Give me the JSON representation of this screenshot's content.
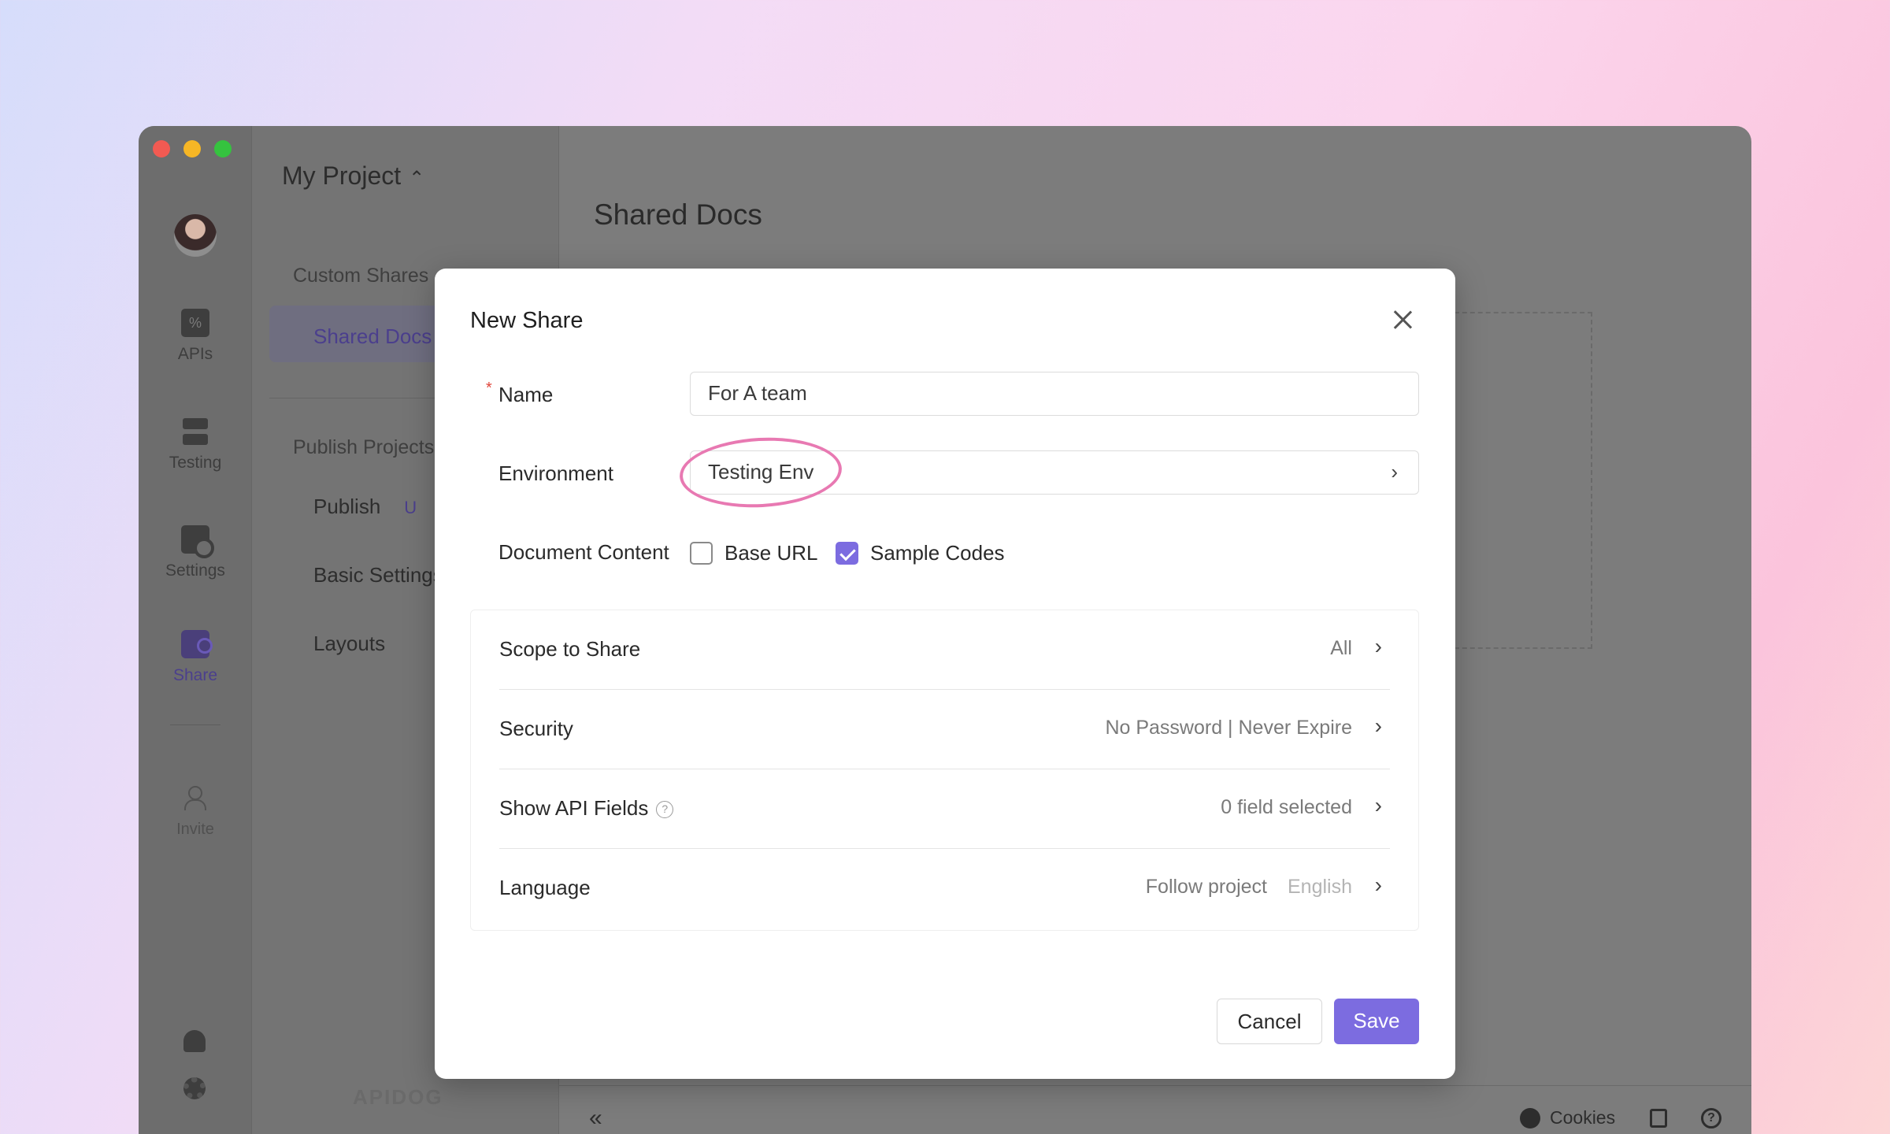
{
  "app": {
    "project": "My Project",
    "main_title": "Shared Docs"
  },
  "rail": {
    "items": [
      {
        "label": "APIs",
        "icon": "apis-icon"
      },
      {
        "label": "Testing",
        "icon": "testing-icon"
      },
      {
        "label": "Settings",
        "icon": "settings-icon"
      },
      {
        "label": "Share",
        "icon": "share-icon"
      },
      {
        "label": "Invite",
        "icon": "invite-icon"
      }
    ]
  },
  "nav": {
    "section_custom": "Custom Shares",
    "item_shared_docs": "Shared Docs",
    "section_publish": "Publish Projects",
    "item_publish": "Publish",
    "item_publish_tag": "U",
    "item_basic_settings": "Basic Settings",
    "item_layouts": "Layouts",
    "watermark": "APIDOG"
  },
  "bottom_bar": {
    "collapse": "«",
    "cookies": "Cookies",
    "help": "?"
  },
  "modal": {
    "title": "New Share",
    "required_mark": "*",
    "name_label": "Name",
    "name_value": "For A team",
    "environment_label": "Environment",
    "environment_value": "Testing Env",
    "document_content_label": "Document Content",
    "base_url_label": "Base URL",
    "base_url_checked": false,
    "sample_codes_label": "Sample Codes",
    "sample_codes_checked": true,
    "rows": [
      {
        "label": "Scope to Share",
        "value": "All"
      },
      {
        "label": "Security",
        "value": "No Password | Never Expire"
      },
      {
        "label": "Show API Fields",
        "value": "0 field selected",
        "help": "?"
      },
      {
        "label": "Language",
        "value": "Follow project",
        "secondary": "English"
      }
    ],
    "cancel_label": "Cancel",
    "save_label": "Save",
    "arrow": "›"
  },
  "colors": {
    "accent": "#7c6ce0",
    "annotation": "#e879b2",
    "required": "#e0453b"
  }
}
